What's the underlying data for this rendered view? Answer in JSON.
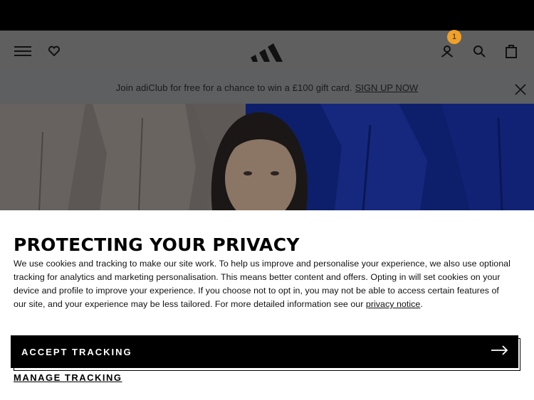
{
  "header": {
    "menu_icon": "hamburger-menu-icon",
    "wishlist_icon": "heart-icon",
    "logo_icon": "adidas-logo",
    "account_icon": "user-icon",
    "account_badge": "1",
    "search_icon": "search-icon",
    "bag_icon": "shopping-bag-icon",
    "badge_color": "#f0a12a"
  },
  "promo": {
    "text": "Join adiClub for free for a chance to win a £100 gift card.",
    "link": "SIGN UP NOW",
    "close_icon": "close-icon"
  },
  "privacy": {
    "title": "PROTECTING YOUR PRIVACY",
    "body": "We use cookies and tracking to make our site work. To help us improve and personalise your experience, we also use optional tracking for analytics and marketing personalisation. This means better content and offers. Opting in will set cookies on your device and profile to improve your experience. If you choose not to opt in, you may not be able to access certain features of our site, and your experience may be less tailored. For more detailed information see our ",
    "link": "privacy notice",
    "after_link": ".",
    "accept_label": "ACCEPT TRACKING",
    "accept_icon": "arrow-right-icon",
    "manage_label": "MANAGE TRACKING"
  }
}
